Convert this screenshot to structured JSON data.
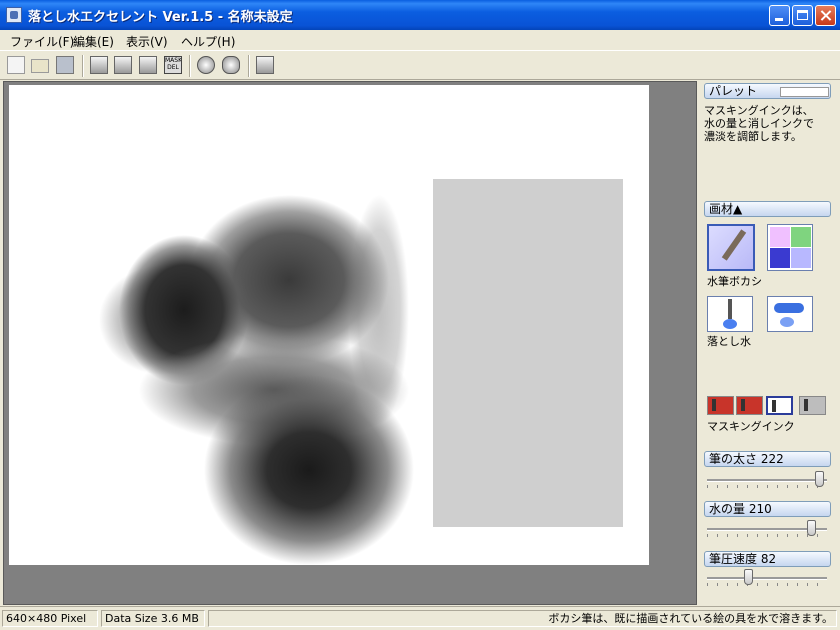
{
  "window": {
    "title": "落とし水エクセレント Ver.1.5 - 名称未設定"
  },
  "menu": [
    "ファイル(F)",
    "編集(E)",
    "表示(V)",
    "ヘルプ(H)"
  ],
  "toolbar": {
    "mask_del": "MASK DEL"
  },
  "panel": {
    "palette_label": "パレット",
    "description": "マスキングインクは、\n水の量と消しインクで\n濃淡を調節します。",
    "media_label": "画材▲",
    "tools": [
      {
        "label": "水筆ボカシ"
      },
      {
        "label": "落とし水"
      }
    ],
    "ink_label": "マスキングインク",
    "sliders": [
      {
        "label": "筆の太さ 222",
        "level": 0.93
      },
      {
        "label": "水の量 210",
        "level": 0.87
      },
      {
        "label": "筆圧速度 82",
        "level": 0.34
      }
    ]
  },
  "status": {
    "size": "640×480 Pixel",
    "data_size": "Data Size 3.6 MB",
    "hint": "ボカシ筆は、既に描画されている絵の具を水で溶きます。"
  }
}
